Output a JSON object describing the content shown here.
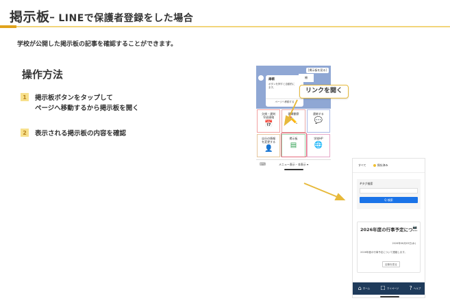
{
  "header": {
    "title_main": "掲示板",
    "title_sub": "ｰ LINEで保護者登録をした場合",
    "lead": "学校が公開した掲示板の記事を確認することができます。"
  },
  "steps_section": {
    "title": "操作方法",
    "steps": [
      {
        "num": "1",
        "line1": "掲示板ボタンをタップして",
        "line2": "ページへ移動するから掲示板を開く"
      },
      {
        "num": "2",
        "line1": "表示される掲示板の内容を確認"
      }
    ]
  },
  "callout": {
    "label": "リンクを開く"
  },
  "phone1": {
    "top_button": "[揭示板を見る]",
    "header_tab": "柵",
    "card_title": "扉帳",
    "card_body_1": "ボタンを押すと自動的に",
    "card_body_2": "ます。",
    "card_link": "ページへ移動する",
    "grid": [
      {
        "label": "欠席・遅刻\n早退連絡",
        "icon": "📅",
        "icon_name": "calendar-icon"
      },
      {
        "label": "健康観察",
        "icon": "✏️",
        "icon_name": "pencil-icon"
      },
      {
        "label": "連絡する",
        "icon": "💬",
        "icon_name": "chat-icon"
      },
      {
        "label": "自分の情報\nを変更する",
        "icon": "👤",
        "icon_name": "person-icon"
      },
      {
        "label": "掲示板",
        "icon": "▤",
        "icon_name": "board-icon"
      },
      {
        "label": "学校HP",
        "icon": "🌐",
        "icon_name": "globe-icon"
      }
    ],
    "bottom_bar": "メニュー表示・非表示 ▾",
    "keyboard_icon": "⌨"
  },
  "phone2": {
    "tab_all": "すべて",
    "tab_saved": "保存済み",
    "search_label": "#タグ検索",
    "search_placeholder": "",
    "search_button": "Q 検索",
    "article_title": "2026年度の行事予定につ...",
    "article_date": "2026年06月03日(水)",
    "article_body": "2026年度の行事予定について連絡します。",
    "article_more": "記事を見る",
    "nav": [
      {
        "icon": "⌂",
        "icon_name": "home-icon",
        "label": "ホーム"
      },
      {
        "icon": "☐",
        "icon_name": "mypage-icon",
        "label": "マイページ"
      },
      {
        "icon": "?",
        "icon_name": "help-icon",
        "label": "ヘルプ"
      }
    ]
  },
  "colors": {
    "accent": "#e0a31c",
    "accent_light": "#f2d57a",
    "step_badge_bg": "#f7e08c",
    "phone1_top": "#8fa7d4",
    "highlight": "#e46a7c",
    "search_button": "#1a73e8",
    "nav_bar": "#1f3b5b"
  }
}
